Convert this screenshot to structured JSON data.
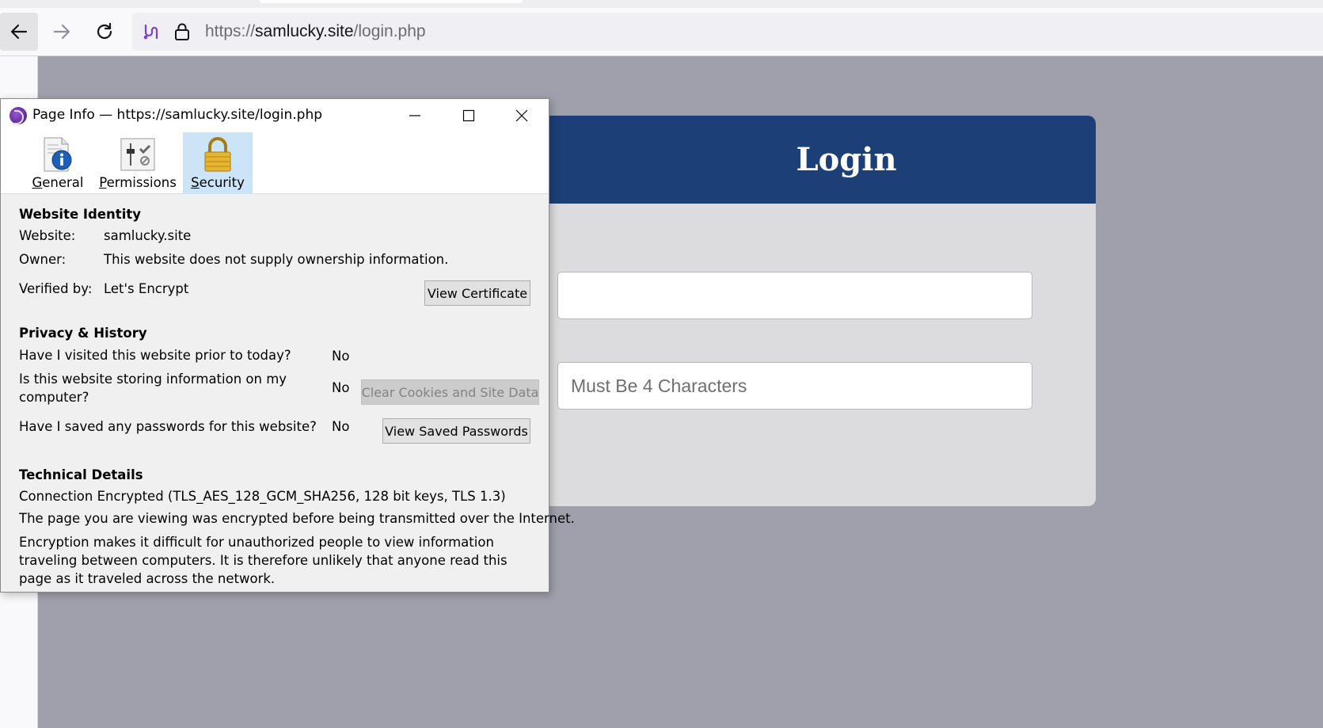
{
  "browser": {
    "url_scheme": "https://",
    "url_host": "samlucky.site",
    "url_path": "/login.php"
  },
  "page": {
    "login_title": "Login",
    "username_placeholder": "",
    "password_placeholder": "Must Be 4 Characters",
    "header_color": "#1c3f78",
    "background_color": "#a0a0ac"
  },
  "dialog": {
    "title": "Page Info — https://samlucky.site/login.php",
    "tabs": [
      {
        "label": "General",
        "icon": "info-document-icon",
        "selected": false
      },
      {
        "label": "Permissions",
        "icon": "permissions-icon",
        "selected": false
      },
      {
        "label": "Security",
        "icon": "padlock-icon",
        "selected": true
      }
    ],
    "identity": {
      "heading": "Website Identity",
      "website_label": "Website:",
      "website_value": "samlucky.site",
      "owner_label": "Owner:",
      "owner_value": "This website does not supply ownership information.",
      "verified_label": "Verified by:",
      "verified_value": "Let's Encrypt",
      "view_certificate_button": "View Certificate"
    },
    "privacy": {
      "heading": "Privacy & History",
      "q_visited": "Have I visited this website prior to today?",
      "a_visited": "No",
      "q_storing_line1": "Is this website storing information on my",
      "q_storing_line2": "computer?",
      "a_storing": "No",
      "clear_cookies_button": "Clear Cookies and Site Data",
      "q_passwords": "Have I saved any passwords for this website?",
      "a_passwords": "No",
      "view_passwords_button": "View Saved Passwords"
    },
    "technical": {
      "heading": "Technical Details",
      "connection": "Connection Encrypted (TLS_AES_128_GCM_SHA256, 128 bit keys, TLS 1.3)",
      "line1": "The page you are viewing was encrypted before being transmitted over the Internet.",
      "line2": "Encryption makes it difficult for unauthorized people to view information traveling between computers. It is therefore unlikely that anyone read this page as it traveled across the network."
    }
  }
}
